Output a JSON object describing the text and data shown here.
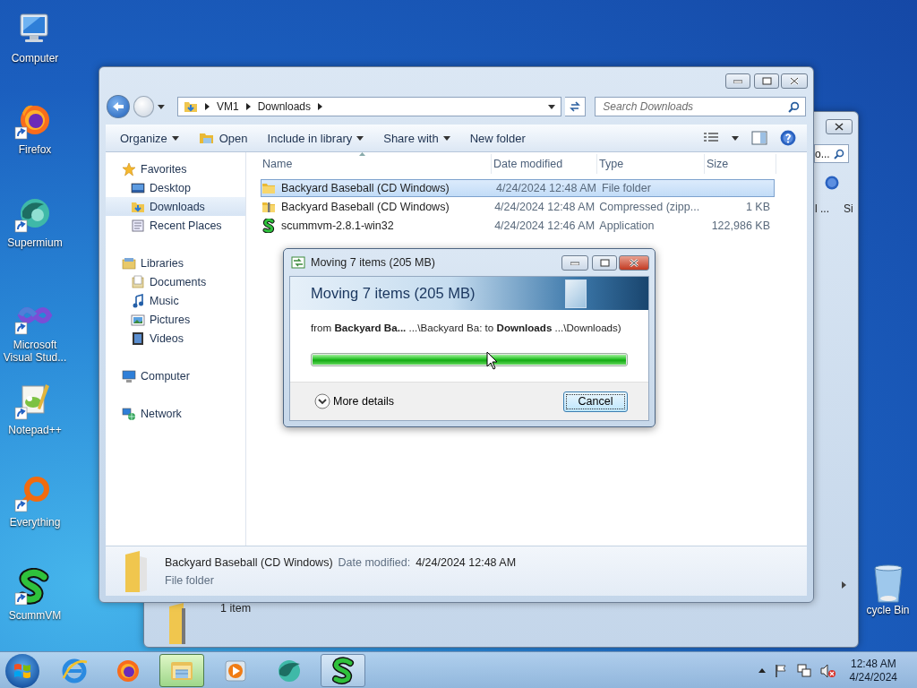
{
  "desktop_icons": [
    {
      "label": "Computer",
      "kind": "computer",
      "shortcut": false
    },
    {
      "label": "Firefox",
      "kind": "firefox",
      "shortcut": true
    },
    {
      "label": "Supermium",
      "kind": "supermium",
      "shortcut": true
    },
    {
      "label": "Microsoft Visual Stud...",
      "kind": "visualstudio",
      "shortcut": true
    },
    {
      "label": "Notepad++",
      "kind": "notepad",
      "shortcut": true
    },
    {
      "label": "Everything",
      "kind": "everything",
      "shortcut": true
    },
    {
      "label": "ScummVM",
      "kind": "scummvm",
      "shortcut": true
    }
  ],
  "recycle_bin": {
    "label": "cycle Bin"
  },
  "back_window": {
    "search_fragment": "o...",
    "column_fragments": [
      "l ...",
      "Si"
    ],
    "status": "1 item"
  },
  "explorer": {
    "breadcrumb": [
      "VM1",
      "Downloads"
    ],
    "search": {
      "placeholder": "Search Downloads"
    },
    "toolbar": [
      {
        "label": "Organize",
        "kind": "menu"
      },
      {
        "label": "Open",
        "kind": "open"
      },
      {
        "label": "Include in library",
        "kind": "menu"
      },
      {
        "label": "Share with",
        "kind": "menu"
      },
      {
        "label": "New folder",
        "kind": "plain"
      }
    ],
    "navigation": [
      {
        "label": "Favorites",
        "kind": "star",
        "selected": false,
        "children": [
          {
            "label": "Desktop",
            "kind": "desktop",
            "selected": false
          },
          {
            "label": "Downloads",
            "kind": "downloads",
            "selected": true
          },
          {
            "label": "Recent Places",
            "kind": "recent",
            "selected": false
          }
        ]
      },
      {
        "label": "Libraries",
        "kind": "libraries",
        "selected": false,
        "children": [
          {
            "label": "Documents",
            "kind": "documents",
            "selected": false
          },
          {
            "label": "Music",
            "kind": "music",
            "selected": false
          },
          {
            "label": "Pictures",
            "kind": "pictures",
            "selected": false
          },
          {
            "label": "Videos",
            "kind": "videos",
            "selected": false
          }
        ]
      },
      {
        "label": "Computer",
        "kind": "computer",
        "selected": false
      },
      {
        "label": "Network",
        "kind": "network",
        "selected": false
      }
    ],
    "table": {
      "columns": [
        "Name",
        "Date modified",
        "Type",
        "Size"
      ],
      "rows": [
        {
          "name": "Backyard Baseball (CD Windows)",
          "kind": "folder",
          "date": "4/24/2024 12:48 AM",
          "type": "File folder",
          "selected": true
        },
        {
          "name": "Backyard Baseball (CD Windows)",
          "kind": "zip",
          "date": "4/24/2024 12:48 AM",
          "type": "Compressed (zipp...",
          "size": "1 KB",
          "selected": false
        },
        {
          "name": "scummvm-2.8.1-win32",
          "kind": "app",
          "date": "4/24/2024 12:46 AM",
          "type": "Application",
          "size": "122,986 KB",
          "selected": false
        }
      ]
    },
    "details": {
      "name": "Backyard Baseball (CD Windows)",
      "date_label": "Date modified:",
      "date": "4/24/2024 12:48 AM",
      "type": "File folder"
    }
  },
  "dialog": {
    "title": "Moving 7 items (205 MB)",
    "heading": "Moving 7 items (205 MB)",
    "detail": "from **Backyard Ba...** ...\\Backyard Ba: to **Downloads** ...\\Downloads)",
    "progress": {
      "level": 1
    },
    "more_details": "More details",
    "cancel": "Cancel"
  },
  "taskbar": {
    "items": [
      {
        "kind": "ie",
        "selected": false,
        "running": false
      },
      {
        "kind": "firefox",
        "selected": false,
        "running": false
      },
      {
        "kind": "explorer",
        "selected": true,
        "running": true
      },
      {
        "kind": "media",
        "selected": false,
        "running": false
      },
      {
        "kind": "supermium",
        "selected": false,
        "running": false
      },
      {
        "kind": "scummvm",
        "selected": false,
        "running": true
      }
    ],
    "clock": {
      "time": "12:48 AM",
      "date": "4/24/2024"
    }
  }
}
